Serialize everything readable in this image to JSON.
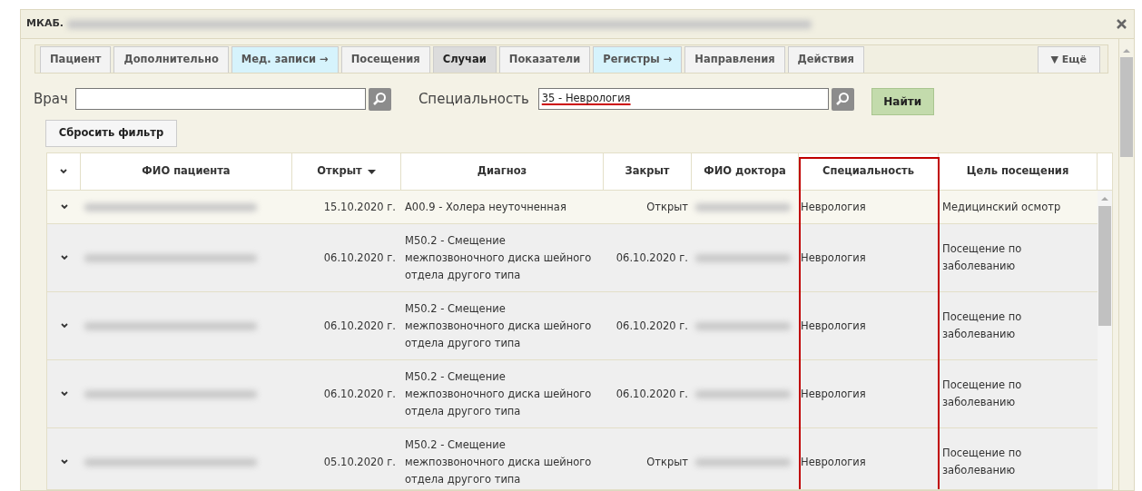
{
  "window": {
    "title": "МКАБ."
  },
  "tabs": [
    {
      "label": "Пациент",
      "selected": false,
      "kind": "plain"
    },
    {
      "label": "Дополнительно",
      "selected": false,
      "kind": "plain"
    },
    {
      "label": "Мед. записи →",
      "selected": false,
      "kind": "link"
    },
    {
      "label": "Посещения",
      "selected": false,
      "kind": "plain"
    },
    {
      "label": "Случаи",
      "selected": true,
      "kind": "plain"
    },
    {
      "label": "Показатели",
      "selected": false,
      "kind": "plain"
    },
    {
      "label": "Регистры →",
      "selected": false,
      "kind": "link"
    },
    {
      "label": "Направления",
      "selected": false,
      "kind": "plain"
    },
    {
      "label": "Действия",
      "selected": false,
      "kind": "plain"
    }
  ],
  "more_button": "▼ Ещё",
  "filter": {
    "doctor_label": "Врач",
    "specialty_label": "Специальность",
    "specialty_value": "35 - Неврология",
    "find_button": "Найти",
    "reset_button": "Сбросить фильтр"
  },
  "table": {
    "columns": [
      {
        "label": "ФИО пациента"
      },
      {
        "label": "Открыт",
        "sorted": true
      },
      {
        "label": "Диагноз"
      },
      {
        "label": "Закрыт"
      },
      {
        "label": "ФИО доктора"
      },
      {
        "label": "Специальность"
      },
      {
        "label": "Цель посещения"
      }
    ],
    "rows": [
      {
        "shaded": false,
        "opened": "15.10.2020 г.",
        "diagnosis": "A00.9 - Холера неуточненная",
        "closed": "Открыт",
        "specialty": "Неврология",
        "purpose": "Медицинский осмотр"
      },
      {
        "shaded": true,
        "opened": "06.10.2020 г.",
        "diagnosis": "M50.2 - Смещение межпозвоночного диска шейного отдела другого типа",
        "closed": "06.10.2020 г.",
        "specialty": "Неврология",
        "purpose": "Посещение по заболеванию"
      },
      {
        "shaded": true,
        "opened": "06.10.2020 г.",
        "diagnosis": "M50.2 - Смещение межпозвоночного диска шейного отдела другого типа",
        "closed": "06.10.2020 г.",
        "specialty": "Неврология",
        "purpose": "Посещение по заболеванию"
      },
      {
        "shaded": true,
        "opened": "06.10.2020 г.",
        "diagnosis": "M50.2 - Смещение межпозвоночного диска шейного отдела другого типа",
        "closed": "06.10.2020 г.",
        "specialty": "Неврология",
        "purpose": "Посещение по заболеванию"
      },
      {
        "shaded": true,
        "opened": "05.10.2020 г.",
        "diagnosis": "M50.2 - Смещение межпозвоночного диска шейного отдела другого типа",
        "closed": "Открыт",
        "specialty": "Неврология",
        "purpose": "Посещение по заболеванию"
      }
    ]
  }
}
